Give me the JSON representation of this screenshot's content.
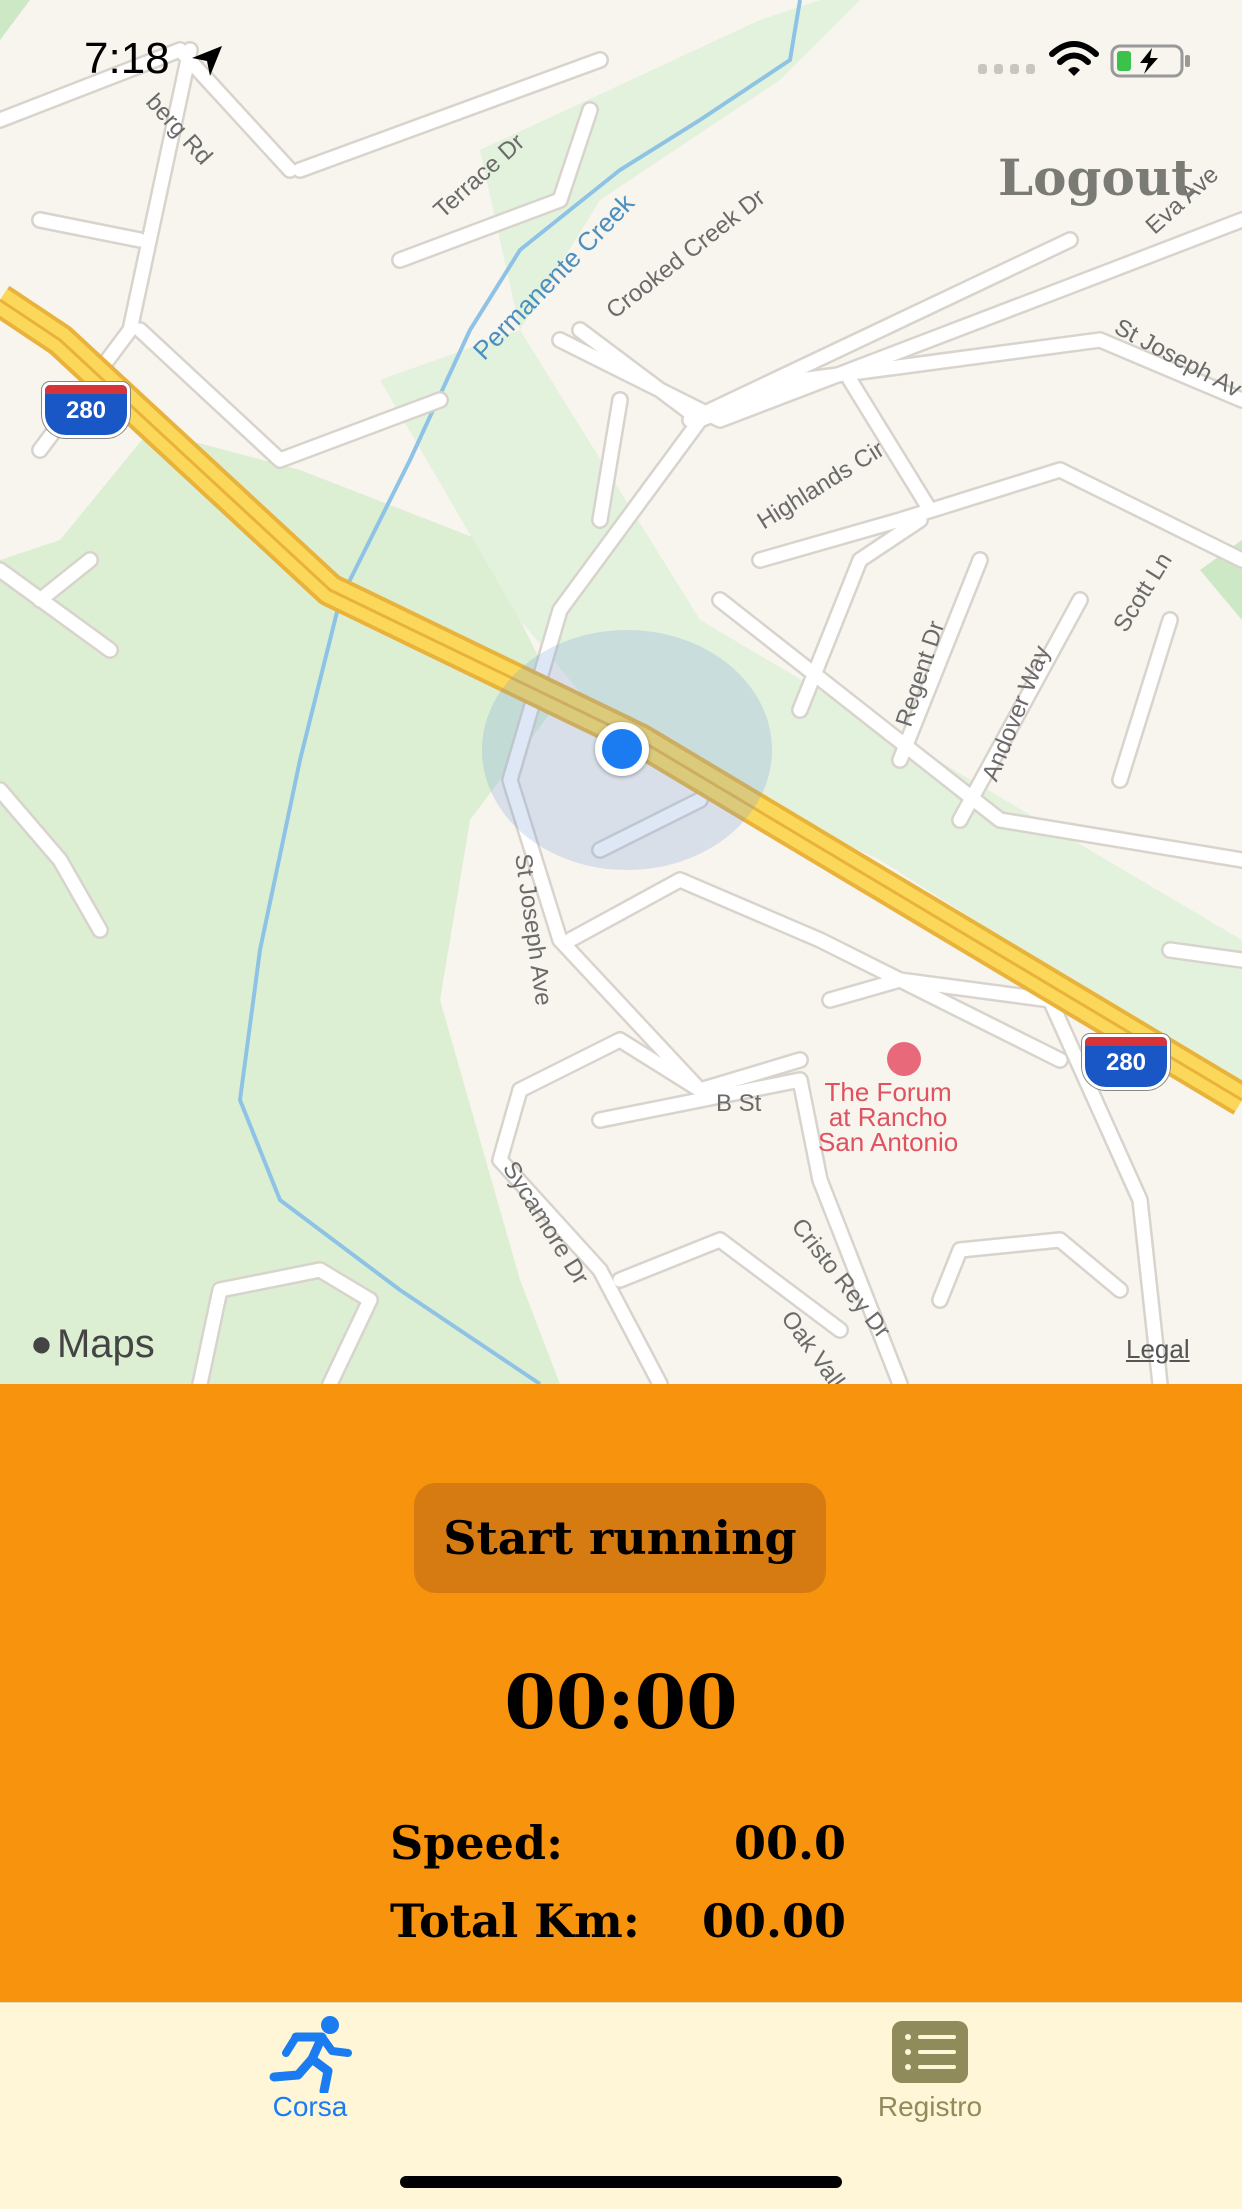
{
  "status": {
    "time": "7:18"
  },
  "header": {
    "logout_label": "Logout"
  },
  "map": {
    "attribution": "Maps",
    "legal_label": "Legal",
    "labels": {
      "terrace": "Terrace Dr",
      "berg": "berg Rd",
      "crooked": "Crooked Creek Dr",
      "permanente": "Permanente Creek",
      "eva": "Eva Ave",
      "stjoseph_ave_ne": "St Joseph Av",
      "highlands": "Highlands Cir",
      "scott": "Scott Ln",
      "regent": "Regent Dr",
      "andover": "Andover Way",
      "stjoseph": "St Joseph Ave",
      "sycamore": "Sycamore Dr",
      "bst": "B St",
      "cristo": "Cristo Rey Dr",
      "oakvalley": "Oak Valley D",
      "hw1": "280",
      "hw2": "280"
    },
    "poi": {
      "line1": "The Forum",
      "line2": "at Rancho",
      "line3": "San Antonio"
    }
  },
  "run": {
    "start_label": "Start running",
    "timer": "00:00",
    "speed_label": "Speed:",
    "speed_value": "00.0",
    "km_label": "Total Km:",
    "km_value": "00.00"
  },
  "tabs": [
    {
      "label": "Corsa",
      "icon": "runner-icon",
      "color": "#1a7cf0",
      "active": true
    },
    {
      "label": "Registro",
      "icon": "list-icon",
      "color": "#8f8b5b",
      "active": false
    }
  ],
  "colors": {
    "panel": "#f7930c",
    "button": "#d67b12",
    "tabbar": "#fff6d8",
    "accent": "#1a7cf0"
  }
}
